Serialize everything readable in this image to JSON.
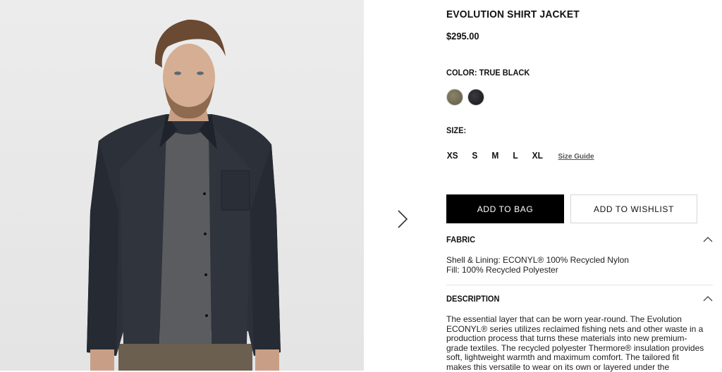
{
  "product": {
    "title": "EVOLUTION SHIRT JACKET",
    "price": "$295.00",
    "color_label": "COLOR: TRUE BLACK",
    "swatches": [
      {
        "name": "olive",
        "color": "#6f6a52"
      },
      {
        "name": "true-black",
        "color": "#1e1e22"
      }
    ],
    "size_label": "SIZE:",
    "sizes": [
      "XS",
      "S",
      "M",
      "L",
      "XL"
    ],
    "size_guide": "Size Guide"
  },
  "actions": {
    "add_to_bag": "ADD TO BAG",
    "add_to_wishlist": "ADD TO WISHLIST"
  },
  "fabric": {
    "heading": "FABRIC",
    "lines": [
      "Shell & Lining: ECONYL® 100% Recycled Nylon",
      "Fill: 100% Recycled Polyester"
    ]
  },
  "description": {
    "heading": "DESCRIPTION",
    "lines": [
      "The essential layer that can be worn year-round. The Evolution",
      "ECONYL® series utilizes reclaimed fishing nets and other waste in a",
      "production process that turns these materials into new premium-",
      "grade textiles. The recycled polyester Thermore® insulation provides",
      "soft, lightweight warmth and maximum comfort. The tailored fit",
      "makes this versatile to wear on its own or layered under the"
    ]
  },
  "icons": {
    "next": "chevron-right-icon",
    "collapse": "chevron-up-icon"
  }
}
